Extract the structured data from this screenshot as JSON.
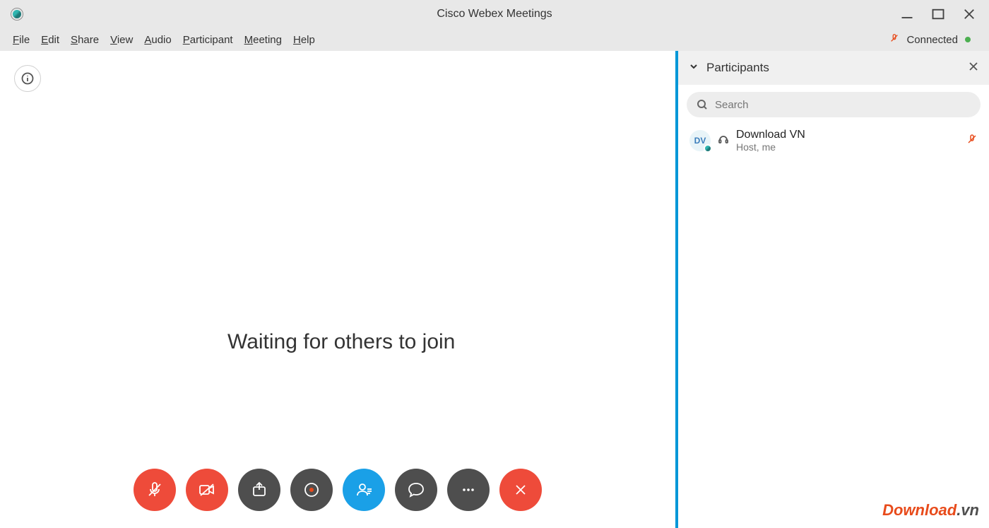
{
  "title": "Cisco Webex Meetings",
  "menus": {
    "file": "File",
    "edit": "Edit",
    "share": "Share",
    "view": "View",
    "audio": "Audio",
    "participant": "Participant",
    "meeting": "Meeting",
    "help": "Help"
  },
  "status": {
    "connected_label": "Connected"
  },
  "main": {
    "waiting_text": "Waiting for others to join"
  },
  "panel": {
    "title": "Participants",
    "search_placeholder": "Search"
  },
  "participants": [
    {
      "initials": "DV",
      "name": "Download VN",
      "role": "Host, me"
    }
  ],
  "watermark": {
    "main": "Download",
    "suffix": ".vn"
  }
}
